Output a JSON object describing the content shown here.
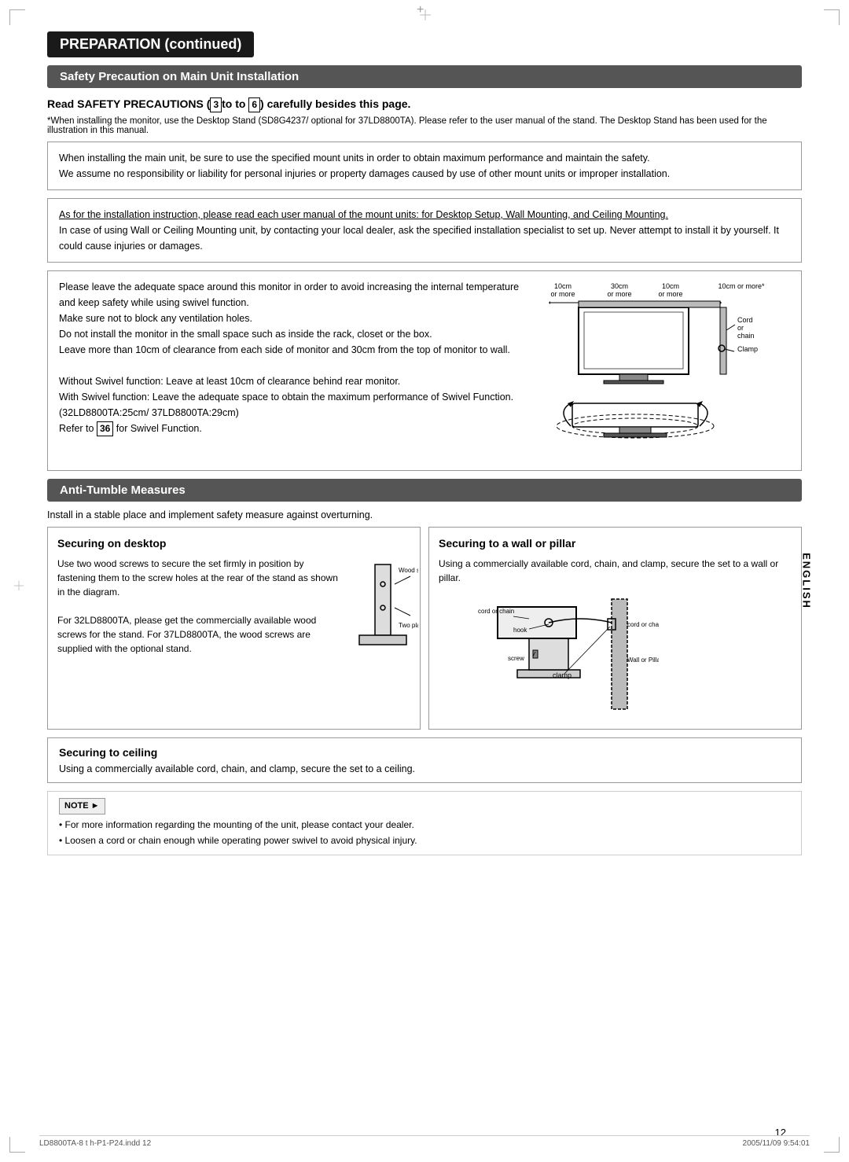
{
  "page": {
    "number": "12",
    "footer_left": "LD8800TA-8 t h-P1-P24.indd  12",
    "footer_right": "2005/11/09  9:54:01"
  },
  "side_label": "ENGLISH",
  "preparation_header": "PREPARATION (continued)",
  "safety_header": "Safety Precaution on Main Unit Installation",
  "read_safety": {
    "title_pre": "Read SAFETY PRECAUTIONS (",
    "num1": "3",
    "title_mid": "to",
    "num2": "6",
    "title_post": ") carefully besides this page.",
    "subtitle": "*When installing the monitor, use the Desktop Stand (SD8G4237/ optional for 37LD8800TA). Please refer to the user manual of the stand. The Desktop Stand has been used for the illustration in this manual."
  },
  "info_box1": {
    "line1": "When installing the main unit, be sure to use the specified mount units in order to obtain maximum performance and maintain the safety.",
    "line2": "We assume no responsibility or liability for personal injuries or property damages caused by use of other mount units or improper installation."
  },
  "info_box2": {
    "underlined": "As for the installation instruction, please read each user manual of the mount units: for Desktop Setup, Wall Mounting, and Ceiling Mounting.",
    "body": "In case of using Wall or Ceiling Mounting unit, by contacting your local dealer, ask the specified installation specialist to set up. Never attempt to install it by yourself. It could cause injuries or damages."
  },
  "diagram_box": {
    "text_lines": [
      "Please leave the adequate space around this monitor in order to avoid increasing the internal temperature and keep safety while using swivel function.",
      "Make sure not to block any ventilation holes.",
      "Do not install the monitor in the small space such as inside the rack, closet or the box.",
      "Leave more than 10cm of clearance from each side of monitor and 30cm from the top of monitor to wall.",
      "",
      "Without Swivel function: Leave at least 10cm of clearance behind rear monitor.",
      "With Swivel function: Leave the adequate space to obtain the maximum performance of Swivel Function.",
      "(32LD8800TA:25cm/ 37LD8800TA:29cm)",
      "Refer to",
      "36",
      "for Swivel Function."
    ],
    "diagram_labels": {
      "top_left": "10cm\nor more",
      "top_center": "30cm\nor more",
      "top_right_inner": "10cm\nor more",
      "top_right_outer": "10cm or more*",
      "cord_chain": "Cord\nor\nchain",
      "clamp": "Clamp"
    }
  },
  "anti_tumble_header": "Anti-Tumble Measures",
  "anti_tumble_intro": "Install in a stable place and implement safety measure against overturning.",
  "securing_desktop": {
    "title": "Securing on desktop",
    "body": "Use two wood screws to secure the set firmly in position by fastening them to the screw holes at the rear of the stand as shown in the diagram.",
    "body2": "For 32LD8800TA, please get the commercially available wood screws for the stand. For 37LD8800TA, the wood screws are supplied with the optional stand.",
    "label1": "Wood screw",
    "label2": "Two places"
  },
  "securing_wall": {
    "title": "Securing to a wall or pillar",
    "body": "Using a commercially available cord, chain, and clamp, secure the set to a wall or pillar.",
    "labels": {
      "cord_chain_top": "cord or chain",
      "hook": "hook",
      "screw": "screw",
      "clamp": "clamp",
      "cord_chain_right": "cord or chain",
      "wall": "Wall or Pillar"
    }
  },
  "securing_ceiling": {
    "title": "Securing to ceiling",
    "body": "Using a commercially available cord, chain, and clamp, secure the set to a ceiling."
  },
  "note": {
    "label": "NOTE",
    "bullets": [
      "For more information regarding the mounting of the unit, please contact your dealer.",
      "Loosen a cord or chain enough while operating power swivel to avoid physical injury."
    ]
  }
}
